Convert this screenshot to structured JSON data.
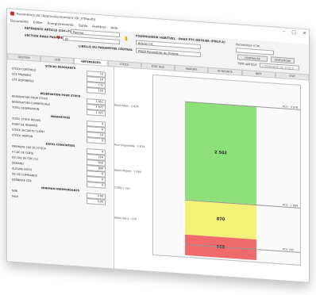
{
  "window": {
    "title": "Paramètres de l'Approvisionnement (Dr_InfSpath)",
    "controls": [
      "–",
      "□",
      "×"
    ]
  },
  "menu": [
    "Documents",
    "Editer",
    "Enregistrements",
    "Outils",
    "Fenêtres",
    "Aide"
  ],
  "toolbar": {
    "ref_label": "REFERENCE ARTICLE (Ctrl+F)",
    "ref_value": "Pomme",
    "section_label": "SECTION DANS PARAMETRAGE",
    "section_value": "ID",
    "fournisseur_label": "FOURNISSEUR HABITUEL - DANS ETC DOSSIER (PRE/F.A)",
    "fournisseur_value": "Article n°6",
    "libelle_label": "LIBELLE DU PARAMETRE CENTRAL",
    "libelle_value": "PNGR Paramètres du Pomme",
    "param_label": "Paramètres n°/m",
    "type_label": "TYPE ARTICLE",
    "type_value": "COMMANDE DE STOCK",
    "btn_calc": "CENTRALISE",
    "btn_gen": "STATISTIQUE"
  },
  "tabs": [
    "GESTION",
    "CDE",
    "REFERENCES",
    "STOCK",
    "ETAT RDC",
    "MARGES",
    "ECHEANCE",
    "RIKT",
    "STAT"
  ],
  "left_panel": {
    "sections": [
      {
        "title": "STOCKS REPOSANTS",
        "rows": [
          {
            "k": "STOCK CONTROLÉ",
            "v": "10"
          },
          {
            "k": "QTE PREPAREE",
            "v": "16"
          },
          {
            "k": "QTE DISPONIBLE",
            "v": "132"
          },
          {
            "k": "",
            "v": "120"
          }
        ]
      },
      {
        "title": "RESERVATION POUR STOCK",
        "rows": [
          {
            "k": "RESERVATION POUR STOCK",
            "v": "1 052"
          },
          {
            "k": "RESERVATION COMMERCIALE",
            "v": "1 871"
          },
          {
            "k": "TOTAL RESERVATION",
            "v": "2 923"
          }
        ]
      },
      {
        "title": "PARAMETRES",
        "rows": [
          {
            "k": "TOTAL STOCK REQUIS",
            "v": "9"
          },
          {
            "k": "POINT DE RÉAPPRO",
            "v": "4"
          },
          {
            "k": "STOCK SECURITE CLIENT",
            "v": "10"
          },
          {
            "k": "STOCK TAMPON",
            "v": "9"
          }
        ]
      },
      {
        "title": "DATES CONSTATEES",
        "rows": [
          {
            "k": "PREMIERE CDE DU STOCK",
            "v": "4"
          },
          {
            "k": "A CDE DE CDE(J)",
            "v": "216"
          },
          {
            "k": "EN CDE DE CDE (%)",
            "v": "656"
          },
          {
            "k": "DEMAND",
            "v": "894"
          },
          {
            "k": "AUCUNE HISTO",
            "v": "0"
          },
          {
            "k": "PIC DE COMMANDE",
            "v": "0"
          },
          {
            "k": "DERNIERE CDE",
            "v": "0"
          }
        ]
      },
      {
        "title": "MINIMUM INDEPENDANTS",
        "rows": [
          {
            "k": "MINI",
            "v": "0,00"
          },
          {
            "k": "MAXI",
            "v": "0,00"
          }
        ]
      }
    ]
  },
  "chart_data": {
    "type": "stacked_bands",
    "side_labels": [
      "Stock Maxi : 2 874",
      "Pour Disponible : 2 874",
      "Stock Moyen : 1 634",
      "COOV 1 (%)",
      "Stock Sécu : 574"
    ],
    "right_labels": [
      "PCV : 3 976",
      "PCV : 1 084",
      "PCV 343"
    ],
    "bands": [
      {
        "value": "2 502",
        "color": "#8ee07a"
      },
      {
        "value": "870",
        "color": "#f5f27a"
      },
      {
        "value": "568",
        "color": "#f06b6b"
      }
    ]
  }
}
